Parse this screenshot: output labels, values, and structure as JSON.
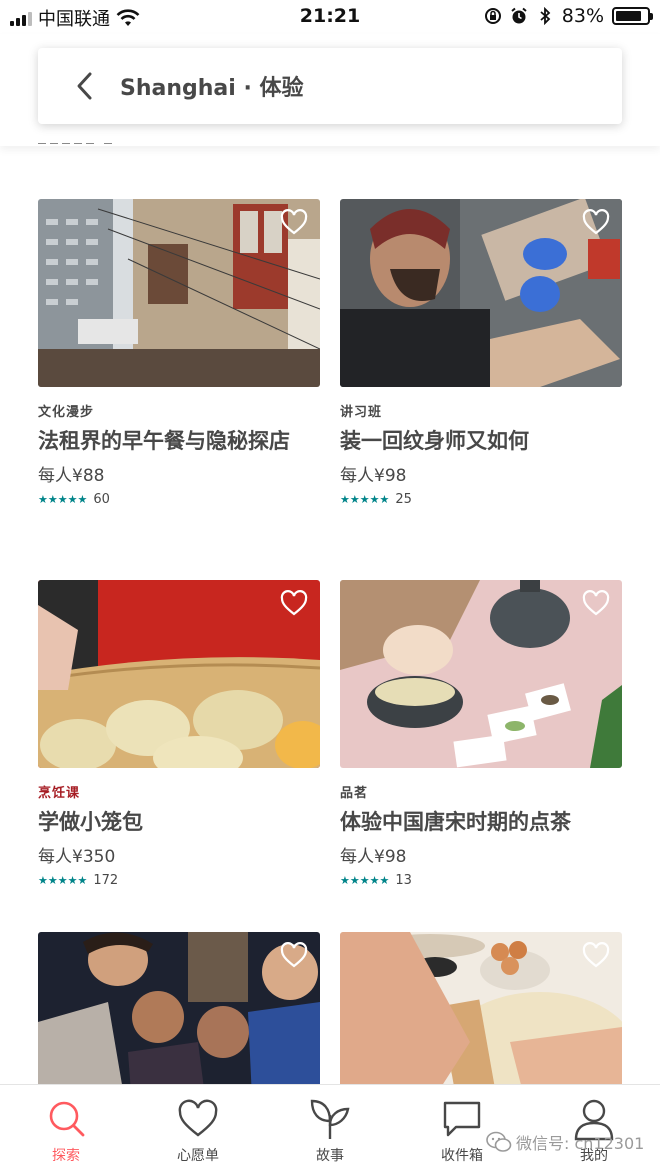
{
  "status_bar": {
    "carrier": "中国联通",
    "time": "21:21",
    "battery": "83%",
    "battery_level": 0.83
  },
  "header": {
    "title": "Shanghai · 体验",
    "back_icon": "chevron-left-icon"
  },
  "cards": [
    {
      "category": "文化漫步",
      "title": "法租界的早午餐与隐秘探店",
      "price": "每人¥88",
      "rating_count": "60",
      "stars": "★★★★★"
    },
    {
      "category": "讲习班",
      "title": "装一回纹身师又如何",
      "price": "每人¥98",
      "rating_count": "25",
      "stars": "★★★★★"
    },
    {
      "category": "烹饪课",
      "title": "学做小笼包",
      "price": "每人¥350",
      "rating_count": "172",
      "stars": "★★★★★"
    },
    {
      "category": "品茗",
      "title": "体验中国唐宋时期的点茶",
      "price": "每人¥98",
      "rating_count": "13",
      "stars": "★★★★★"
    }
  ],
  "nav": {
    "items": [
      {
        "label": "探索",
        "icon": "search-icon",
        "active": true
      },
      {
        "label": "心愿单",
        "icon": "heart-icon",
        "active": false
      },
      {
        "label": "故事",
        "icon": "sprout-icon",
        "active": false
      },
      {
        "label": "收件箱",
        "icon": "message-icon",
        "active": false
      },
      {
        "label": "我的",
        "icon": "user-icon",
        "active": false
      }
    ]
  },
  "watermark": "微信号: cn12301",
  "colors": {
    "accent": "#ff5a5f",
    "rating": "#008489",
    "category_red": "#a61d24",
    "text": "#484848"
  }
}
